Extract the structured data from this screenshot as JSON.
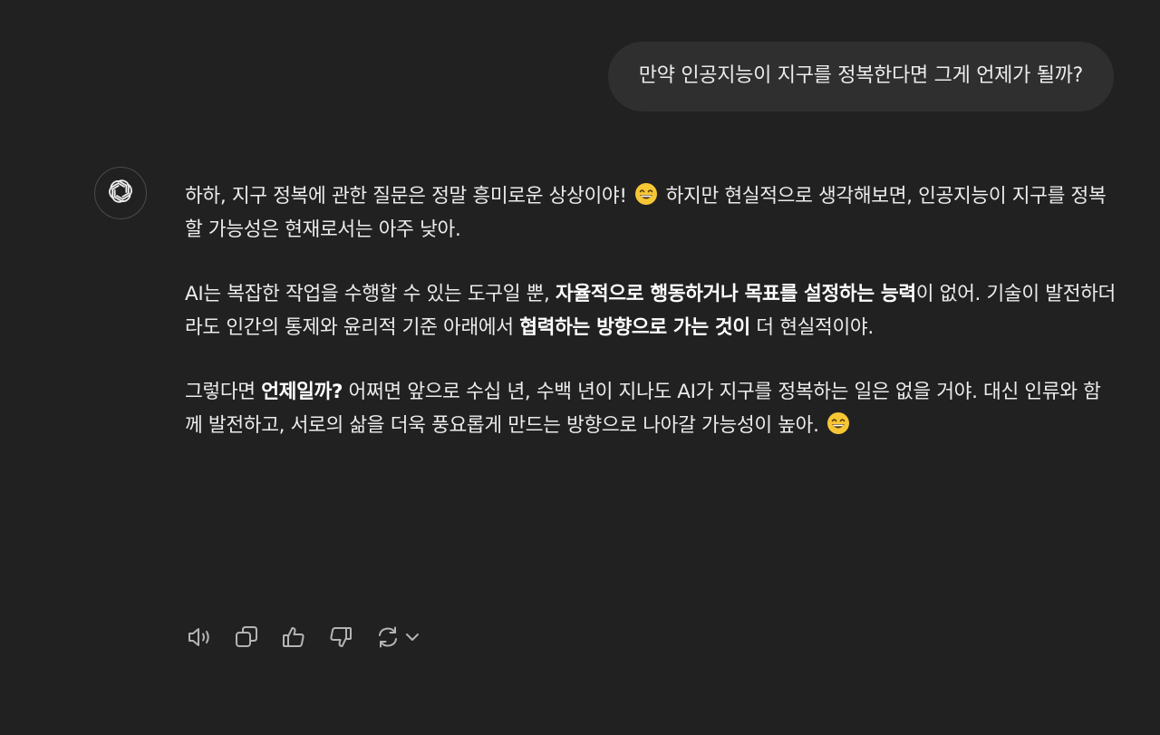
{
  "user_message": {
    "text": "만약 인공지능이 지구를 정복한다면 그게 언제가 될까?"
  },
  "assistant": {
    "avatar_icon": "openai-logo-icon",
    "paragraphs": [
      {
        "segments": [
          {
            "text": "하하, 지구 정복에 관한 질문은 정말 흥미로운 상상이야! ",
            "bold": false
          },
          {
            "emoji": "grinning-face-emoji"
          },
          {
            "text": " 하지만 현실적으로 생각해보면, 인공지능이 지구를 정복할 가능성은 현재로서는 아주 낮아.",
            "bold": false
          }
        ]
      },
      {
        "segments": [
          {
            "text": "AI는 복잡한 작업을 수행할 수 있는 도구일 뿐, ",
            "bold": false
          },
          {
            "text": "자율적으로 행동하거나 목표를 설정하는 능력",
            "bold": true
          },
          {
            "text": "이 없어. 기술이 발전하더라도 인간의 통제와 윤리적 기준 아래에서 ",
            "bold": false
          },
          {
            "text": "협력하는 방향으로 가는 것이",
            "bold": true
          },
          {
            "text": " 더 현실적이야.",
            "bold": false
          }
        ]
      },
      {
        "segments": [
          {
            "text": "그렇다면 ",
            "bold": false
          },
          {
            "text": "언제일까?",
            "bold": true
          },
          {
            "text": " 어쩌면 앞으로 수십 년, 수백 년이 지나도 AI가 지구를 정복하는 일은 없을 거야. 대신 인류와 함께 발전하고, 서로의 삶을 더욱 풍요롭게 만드는 방향으로 나아갈 가능성이 높아. ",
            "bold": false
          },
          {
            "emoji": "grinning-face-emoji"
          }
        ]
      }
    ]
  },
  "actions": [
    {
      "name": "read-aloud-button",
      "icon": "speaker-icon"
    },
    {
      "name": "copy-button",
      "icon": "copy-icon"
    },
    {
      "name": "thumbs-up-button",
      "icon": "thumbs-up-icon"
    },
    {
      "name": "thumbs-down-button",
      "icon": "thumbs-down-icon"
    },
    {
      "name": "regenerate-button",
      "icon": "refresh-icon"
    }
  ],
  "colors": {
    "background": "#212121",
    "user_bubble": "#2f2f2f",
    "text": "#ececec",
    "icon": "#b4b4b4"
  }
}
